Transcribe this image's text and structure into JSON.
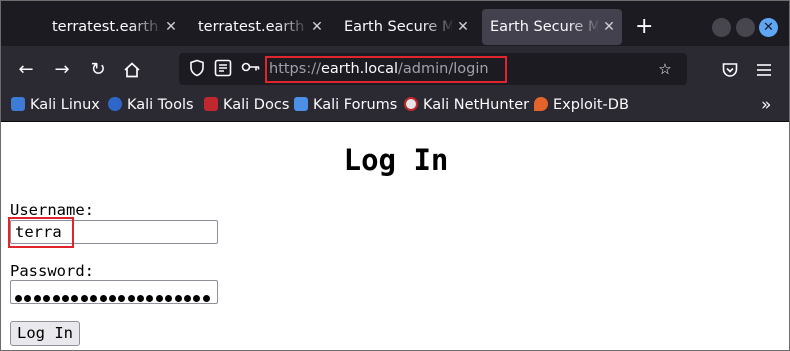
{
  "tabs": [
    {
      "label": "terratest.earth.lo",
      "active": false
    },
    {
      "label": "terratest.earth.lo",
      "active": false
    },
    {
      "label": "Earth Secure Mes",
      "active": false
    },
    {
      "label": "Earth Secure Mes",
      "active": true
    }
  ],
  "new_tab_label": "+",
  "url": {
    "scheme": "https://",
    "host": "earth.local",
    "path": "/admin/login"
  },
  "bookmarks": [
    {
      "label": "Kali Linux",
      "icon": "kali-dragon-icon"
    },
    {
      "label": "Kali Tools",
      "icon": "kali-tools-icon"
    },
    {
      "label": "Kali Docs",
      "icon": "kali-docs-icon"
    },
    {
      "label": "Kali Forums",
      "icon": "kali-forums-icon"
    },
    {
      "label": "Kali NetHunter",
      "icon": "kali-nethunter-icon"
    },
    {
      "label": "Exploit-DB",
      "icon": "exploit-db-icon"
    }
  ],
  "page": {
    "title": "Log In",
    "username_label": "Username:",
    "username_value": "terra",
    "password_label": "Password:",
    "password_length": 21,
    "login_button": "Log In"
  },
  "colors": {
    "highlight": "#e0262c",
    "toolbar": "#2b2a33",
    "tabstrip": "#1c1b22",
    "accent": "#5fa6f4"
  }
}
